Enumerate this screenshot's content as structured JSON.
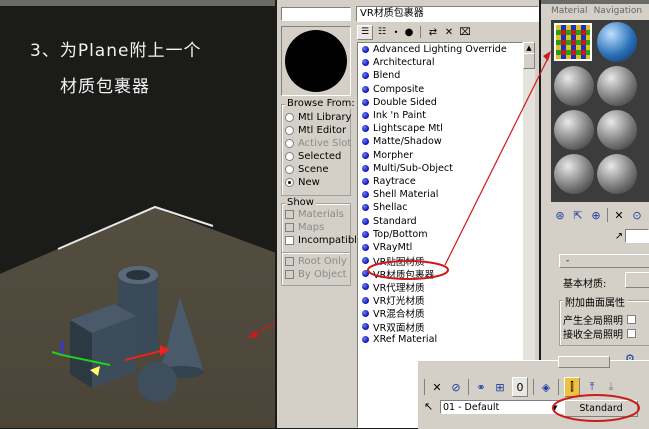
{
  "viewport": {
    "caption_line1": "3、为Plane附上一个",
    "caption_line2": "材质包裹器"
  },
  "browser": {
    "title": "VR材质包裹器",
    "browse_from": {
      "title": "Browse From:",
      "options": [
        {
          "label": "Mtl Library",
          "selected": false,
          "disabled": false
        },
        {
          "label": "Mtl Editor",
          "selected": false,
          "disabled": false
        },
        {
          "label": "Active Slot",
          "selected": false,
          "disabled": true
        },
        {
          "label": "Selected",
          "selected": false,
          "disabled": false
        },
        {
          "label": "Scene",
          "selected": false,
          "disabled": false
        },
        {
          "label": "New",
          "selected": true,
          "disabled": false
        }
      ]
    },
    "show": {
      "title": "Show",
      "options": [
        {
          "label": "Materials",
          "checked": true,
          "disabled": true
        },
        {
          "label": "Maps",
          "checked": false,
          "disabled": true
        },
        {
          "label": "Incompatible",
          "checked": false,
          "disabled": false
        }
      ]
    },
    "filter": {
      "options": [
        {
          "label": "Root Only",
          "checked": true,
          "disabled": true
        },
        {
          "label": "By Object",
          "checked": false,
          "disabled": true
        }
      ]
    },
    "materials": [
      "Advanced Lighting Override",
      "Architectural",
      "Blend",
      "Composite",
      "Double Sided",
      "Ink 'n Paint",
      "Lightscape Mtl",
      "Matte/Shadow",
      "Morpher",
      "Multi/Sub-Object",
      "Raytrace",
      "Shell Material",
      "Shellac",
      "Standard",
      "Top/Bottom",
      "VRayMtl",
      "VR贴图材质",
      "VR材质包裹器",
      "VR代理材质",
      "VR灯光材质",
      "VR混合材质",
      "VR双面材质",
      "XRef Material"
    ],
    "selected_material": "VR材质包裹器"
  },
  "editor": {
    "menu": [
      "Material",
      "Navigation"
    ],
    "base_material_label": "基本材质:",
    "extra_surface_label": "附加曲面属性",
    "gen_gi_label": "产生全局照明",
    "recv_gi_label": "接收全局照明",
    "rollout_sign": "-"
  },
  "bottom": {
    "material_name": "01 - Default",
    "type_button": "Standard"
  },
  "colors": {
    "highlight": "#cc1a1a",
    "ui_gray": "#d4d0c8",
    "material_dot": "#1a26c8"
  }
}
